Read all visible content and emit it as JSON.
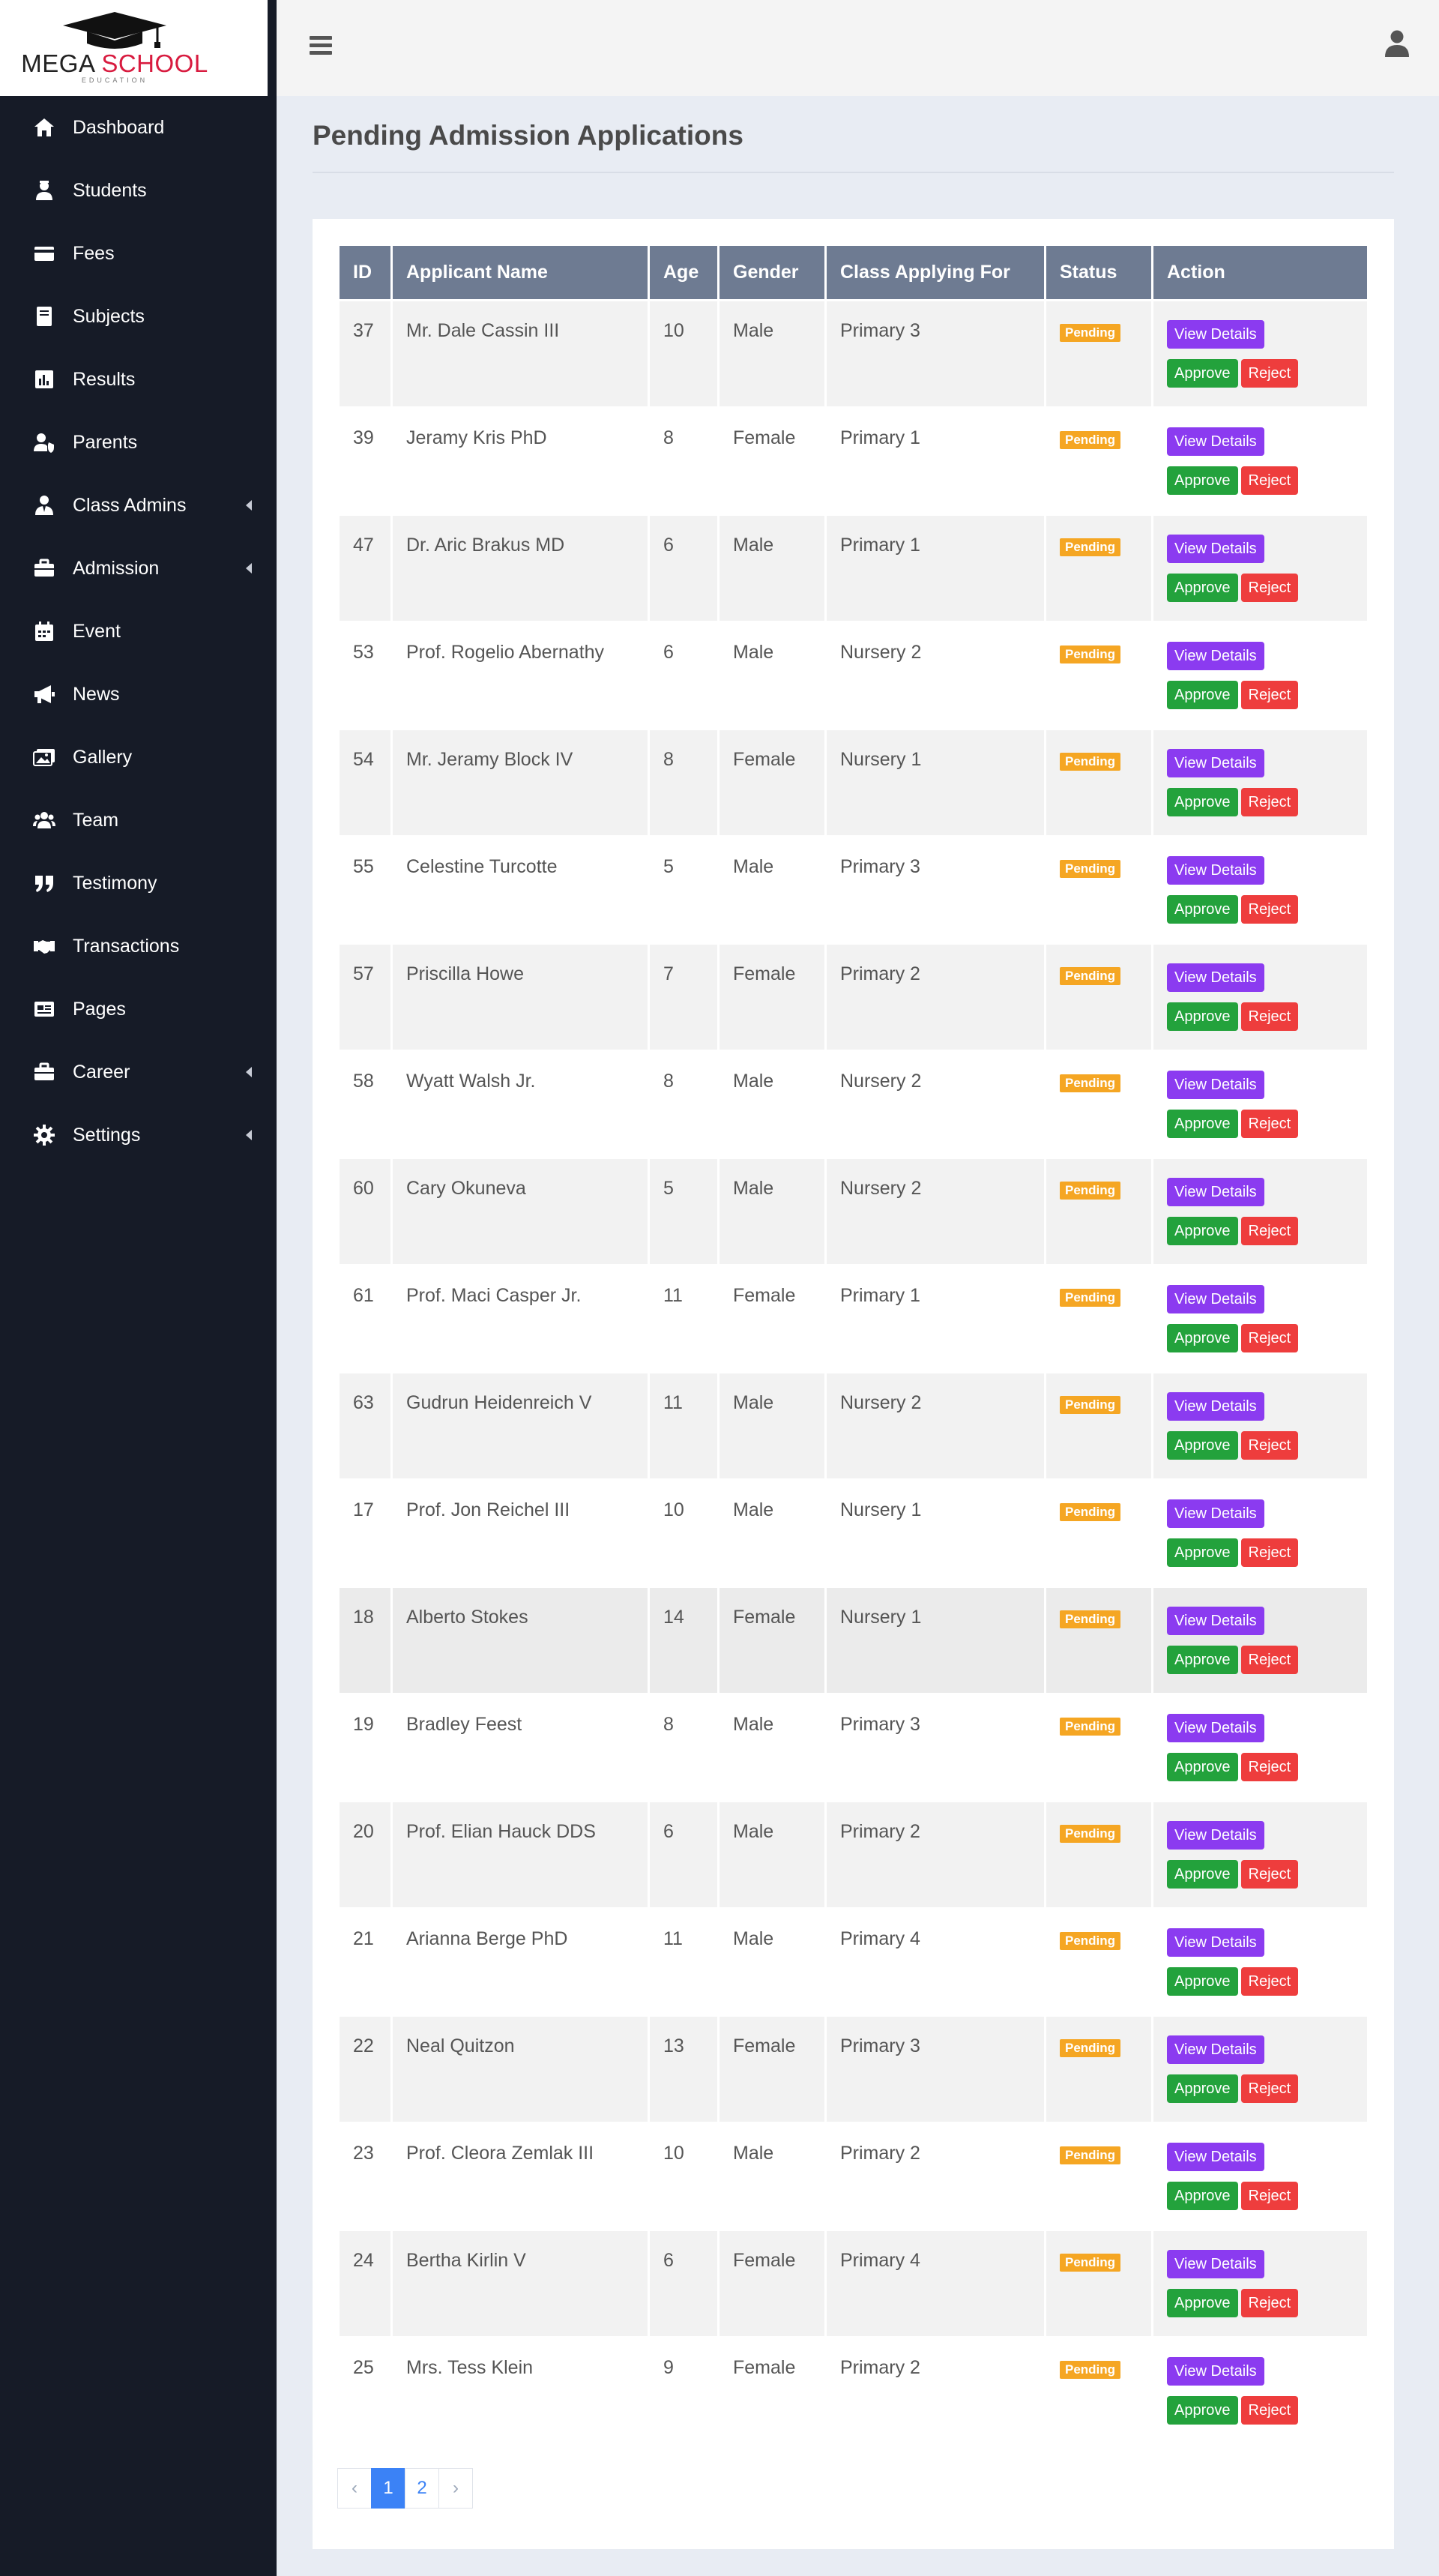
{
  "brand": {
    "name_part1": "MEGA",
    "name_part2": "SCHOOL",
    "tagline": "EDUCATION",
    "accent_color": "#d81b3f"
  },
  "sidebar": {
    "items": [
      {
        "label": "Dashboard",
        "icon": "home-icon"
      },
      {
        "label": "Students",
        "icon": "student-icon"
      },
      {
        "label": "Fees",
        "icon": "credit-card-icon"
      },
      {
        "label": "Subjects",
        "icon": "book-icon"
      },
      {
        "label": "Results",
        "icon": "bar-chart-icon"
      },
      {
        "label": "Parents",
        "icon": "user-shield-icon"
      },
      {
        "label": "Class Admins",
        "icon": "user-tie-icon",
        "has_submenu": true
      },
      {
        "label": "Admission",
        "icon": "briefcase-icon",
        "has_submenu": true
      },
      {
        "label": "Event",
        "icon": "calendar-icon"
      },
      {
        "label": "News",
        "icon": "megaphone-icon"
      },
      {
        "label": "Gallery",
        "icon": "images-icon"
      },
      {
        "label": "Team",
        "icon": "users-icon"
      },
      {
        "label": "Testimony",
        "icon": "quote-icon"
      },
      {
        "label": "Transactions",
        "icon": "handshake-icon"
      },
      {
        "label": "Pages",
        "icon": "pages-icon"
      },
      {
        "label": "Career",
        "icon": "briefcase-icon",
        "has_submenu": true
      },
      {
        "label": "Settings",
        "icon": "gear-icon",
        "has_submenu": true
      }
    ]
  },
  "header": {
    "menu_icon": "hamburger-icon",
    "user_icon": "user-icon"
  },
  "page": {
    "title": "Pending Admission Applications"
  },
  "table": {
    "columns": [
      "ID",
      "Applicant Name",
      "Age",
      "Gender",
      "Class Applying For",
      "Status",
      "Action"
    ],
    "actions": {
      "view": "View Details",
      "approve": "Approve",
      "reject": "Reject"
    },
    "rows": [
      {
        "id": "37",
        "name": "Mr. Dale Cassin III",
        "age": "10",
        "gender": "Male",
        "class": "Primary 3",
        "status": "Pending"
      },
      {
        "id": "39",
        "name": "Jeramy Kris PhD",
        "age": "8",
        "gender": "Female",
        "class": "Primary 1",
        "status": "Pending"
      },
      {
        "id": "47",
        "name": "Dr. Aric Brakus MD",
        "age": "6",
        "gender": "Male",
        "class": "Primary 1",
        "status": "Pending"
      },
      {
        "id": "53",
        "name": "Prof. Rogelio Abernathy",
        "age": "6",
        "gender": "Male",
        "class": "Nursery 2",
        "status": "Pending"
      },
      {
        "id": "54",
        "name": "Mr. Jeramy Block IV",
        "age": "8",
        "gender": "Female",
        "class": "Nursery 1",
        "status": "Pending"
      },
      {
        "id": "55",
        "name": "Celestine Turcotte",
        "age": "5",
        "gender": "Male",
        "class": "Primary 3",
        "status": "Pending"
      },
      {
        "id": "57",
        "name": "Priscilla Howe",
        "age": "7",
        "gender": "Female",
        "class": "Primary 2",
        "status": "Pending"
      },
      {
        "id": "58",
        "name": "Wyatt Walsh Jr.",
        "age": "8",
        "gender": "Male",
        "class": "Nursery 2",
        "status": "Pending"
      },
      {
        "id": "60",
        "name": "Cary Okuneva",
        "age": "5",
        "gender": "Male",
        "class": "Nursery 2",
        "status": "Pending"
      },
      {
        "id": "61",
        "name": "Prof. Maci Casper Jr.",
        "age": "11",
        "gender": "Female",
        "class": "Primary 1",
        "status": "Pending"
      },
      {
        "id": "63",
        "name": "Gudrun Heidenreich V",
        "age": "11",
        "gender": "Male",
        "class": "Nursery 2",
        "status": "Pending"
      },
      {
        "id": "17",
        "name": "Prof. Jon Reichel III",
        "age": "10",
        "gender": "Male",
        "class": "Nursery 1",
        "status": "Pending"
      },
      {
        "id": "18",
        "name": "Alberto Stokes",
        "age": "14",
        "gender": "Female",
        "class": "Nursery 1",
        "status": "Pending",
        "highlight": true
      },
      {
        "id": "19",
        "name": "Bradley Feest",
        "age": "8",
        "gender": "Male",
        "class": "Primary 3",
        "status": "Pending"
      },
      {
        "id": "20",
        "name": "Prof. Elian Hauck DDS",
        "age": "6",
        "gender": "Male",
        "class": "Primary 2",
        "status": "Pending"
      },
      {
        "id": "21",
        "name": "Arianna Berge PhD",
        "age": "11",
        "gender": "Male",
        "class": "Primary 4",
        "status": "Pending"
      },
      {
        "id": "22",
        "name": "Neal Quitzon",
        "age": "13",
        "gender": "Female",
        "class": "Primary 3",
        "status": "Pending"
      },
      {
        "id": "23",
        "name": "Prof. Cleora Zemlak III",
        "age": "10",
        "gender": "Male",
        "class": "Primary 2",
        "status": "Pending"
      },
      {
        "id": "24",
        "name": "Bertha Kirlin V",
        "age": "6",
        "gender": "Female",
        "class": "Primary 4",
        "status": "Pending"
      },
      {
        "id": "25",
        "name": "Mrs. Tess Klein",
        "age": "9",
        "gender": "Female",
        "class": "Primary 2",
        "status": "Pending"
      }
    ]
  },
  "pagination": {
    "prev": "‹",
    "pages": [
      "1",
      "2"
    ],
    "current": "1",
    "next": "›"
  },
  "colors": {
    "sidebar_bg": "#161b27",
    "header_row": "#6e7b92",
    "pending": "#f5a623",
    "view": "#8b3bf0",
    "approve": "#23a23c",
    "reject": "#ee3d3d",
    "active_page": "#3b82f6"
  }
}
